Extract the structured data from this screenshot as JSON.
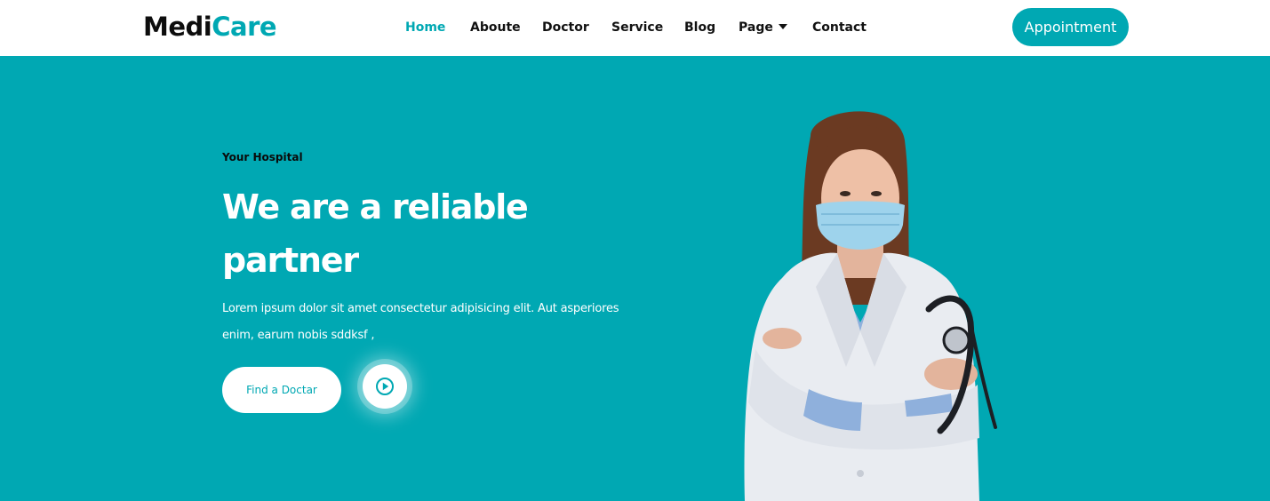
{
  "header": {
    "logo": {
      "part1": "Medi",
      "part2": "Care"
    },
    "nav": [
      {
        "label": "Home",
        "active": true
      },
      {
        "label": "Aboute",
        "active": false
      },
      {
        "label": "Doctor",
        "active": false
      },
      {
        "label": "Service",
        "active": false
      },
      {
        "label": "Blog",
        "active": false
      },
      {
        "label": "Page",
        "active": false,
        "dropdown": true
      },
      {
        "label": "Contact",
        "active": false
      }
    ],
    "appointment_label": "Appointment"
  },
  "hero": {
    "eyebrow": "Your Hospital",
    "headline_line1": "We are a reliable",
    "headline_line2": "partner",
    "lede_line1": "Lorem ipsum dolor sit amet consectetur adipisicing elit. Aut asperiores",
    "lede_line2": "enim, earum nobis sddksf ,",
    "find_label": "Find a Doctar",
    "play_icon": "play-circle-icon",
    "image": "doctor-with-mask-and-stethoscope"
  },
  "colors": {
    "accent": "#00a8b3",
    "dark": "#111111",
    "white": "#ffffff"
  }
}
